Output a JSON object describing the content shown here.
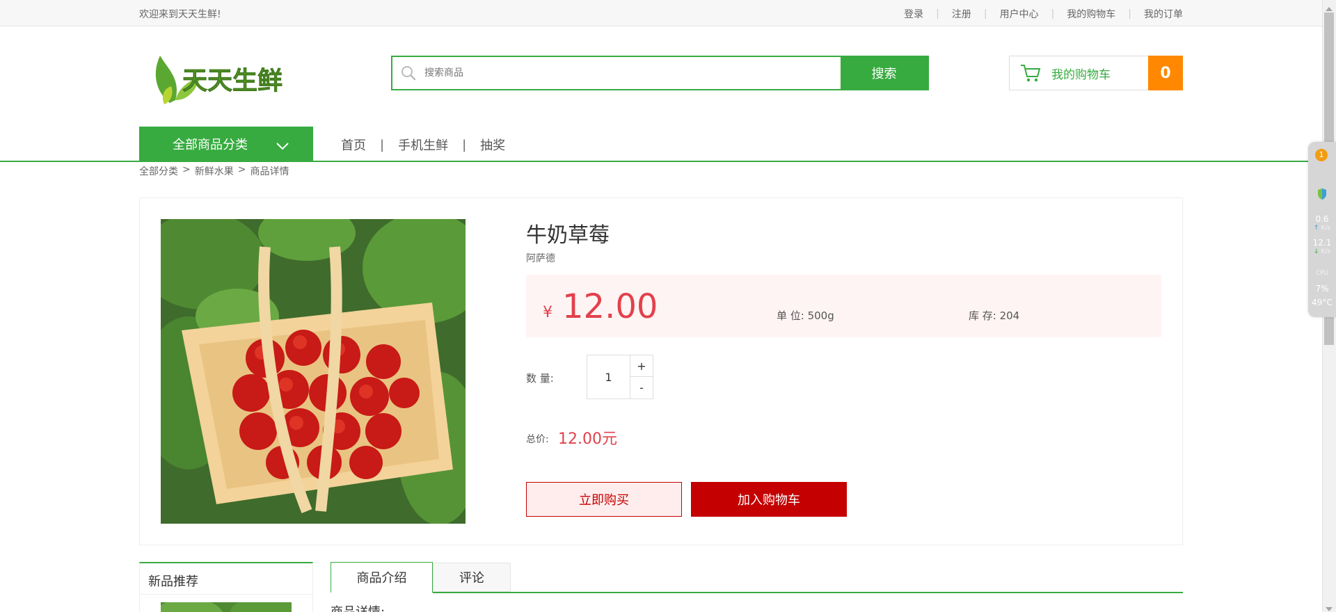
{
  "topbar": {
    "welcome": "欢迎来到天天生鲜!",
    "links": [
      "登录",
      "注册",
      "用户中心",
      "我的购物车",
      "我的订单"
    ]
  },
  "logo": {
    "text": "天天生鲜"
  },
  "search": {
    "placeholder": "搜索商品",
    "button": "搜索"
  },
  "cart": {
    "label": "我的购物车",
    "count": "0"
  },
  "nav": {
    "category_button": "全部商品分类",
    "links": [
      "首页",
      "手机生鲜",
      "抽奖"
    ]
  },
  "breadcrumb": [
    "全部分类",
    "新鲜水果",
    "商品详情"
  ],
  "product": {
    "name": "牛奶草莓",
    "brand": "阿萨德",
    "currency": "¥",
    "price": "12.00",
    "unit": "单 位: 500g",
    "stock": "库 存: 204",
    "quantity_label": "数 量:",
    "quantity": "1",
    "plus": "+",
    "minus": "-",
    "total_label": "总价:",
    "total": "12.00元",
    "buy_now": "立即购买",
    "add_to_cart": "加入购物车"
  },
  "sidebar": {
    "title": "新品推荐"
  },
  "tabs": [
    "商品介绍",
    "评论"
  ],
  "detail_label": "商品详情:",
  "widget": {
    "badge": "1",
    "up_value": "0.6",
    "up_unit": "K/s",
    "down_value": "12.1",
    "down_unit": "K/s",
    "cpu_label": "CPU",
    "cpu_value": "7%",
    "temp_value": "49°C"
  },
  "colors": {
    "accent": "#37ab40",
    "price": "#e2414c",
    "cart_count": "#ff8800",
    "buy_red": "#c40000"
  }
}
